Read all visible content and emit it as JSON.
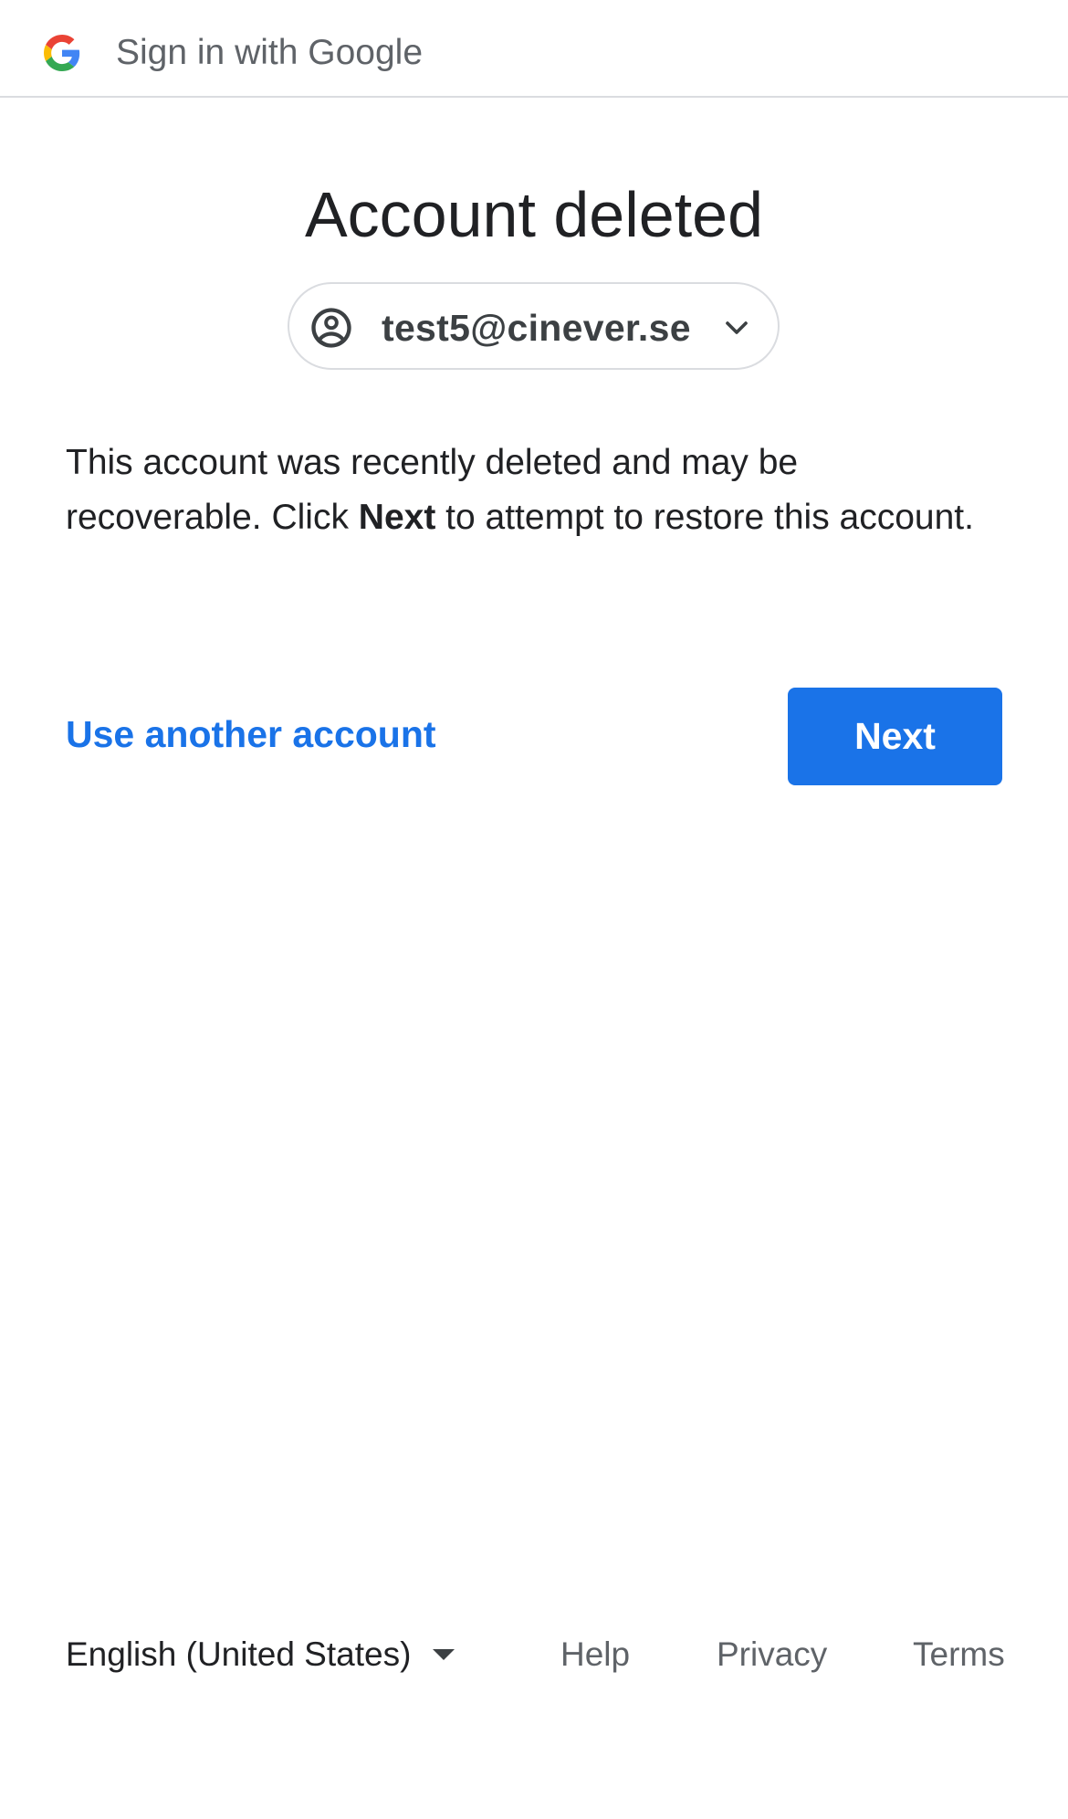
{
  "header": {
    "title": "Sign in with Google",
    "logo_icon": "google-g-icon"
  },
  "main": {
    "heading": "Account deleted",
    "account_chip": {
      "email": "test5@cinever.se",
      "avatar_icon": "account-circle-icon",
      "chevron_icon": "chevron-down-icon"
    },
    "message": {
      "part1": "This account was recently deleted and may be recoverable. Click ",
      "bold": "Next",
      "part2": " to attempt to restore this account."
    },
    "actions": {
      "secondary_label": "Use another account",
      "primary_label": "Next"
    }
  },
  "footer": {
    "language": "English (United States)",
    "language_arrow_icon": "caret-down-icon",
    "links": {
      "help": "Help",
      "privacy": "Privacy",
      "terms": "Terms"
    }
  },
  "colors": {
    "primary": "#1a73e8",
    "text": "#202124",
    "muted": "#5f6368",
    "border": "#dadce0"
  }
}
